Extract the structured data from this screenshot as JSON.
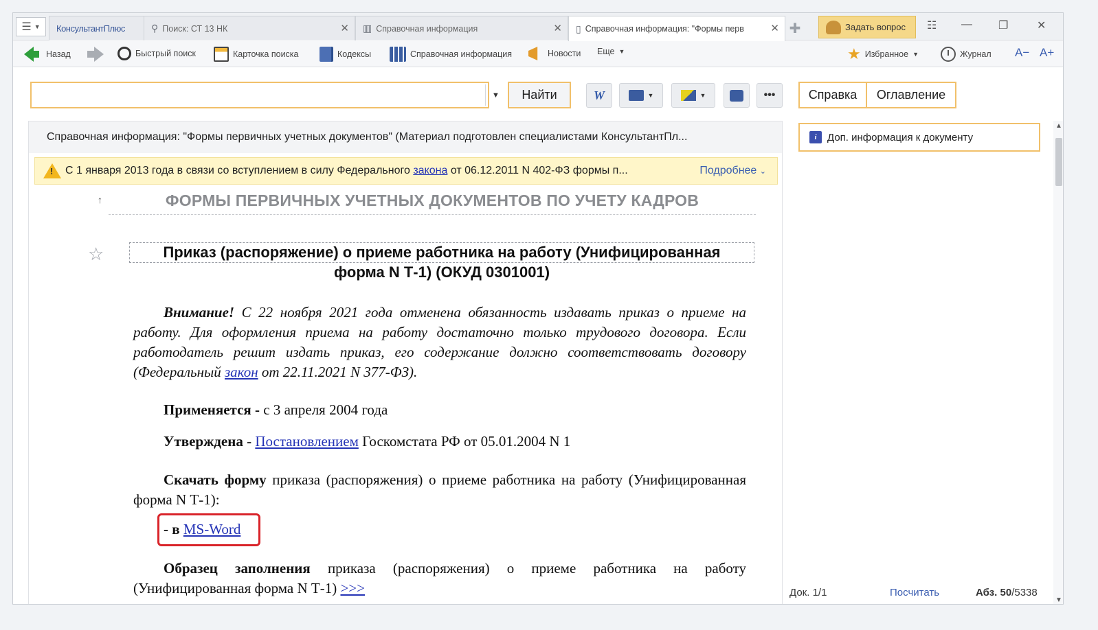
{
  "tabs": {
    "brand": "КонсультантПлюс",
    "search_tab": "Поиск: СТ 13 НК",
    "ref_tab": "Справочная информация",
    "active_tab": "Справочная информация: \"Формы перв",
    "ask": "Задать вопрос"
  },
  "toolbar": {
    "back": "Назад",
    "quick_search": "Быстрый поиск",
    "search_card": "Карточка поиска",
    "codes": "Кодексы",
    "reference": "Справочная информация",
    "news": "Новости",
    "more": "Еще",
    "favorites": "Избранное",
    "journal": "Журнал",
    "font_minus": "A−",
    "font_plus": "A+"
  },
  "search": {
    "value": "",
    "find": "Найти"
  },
  "side_tabs": {
    "help": "Справка",
    "contents": "Оглавление",
    "extra_info": "Доп. информация к документу"
  },
  "document": {
    "title": "Справочная информация: \"Формы первичных учетных документов\" (Материал подготовлен специалистами КонсультантПл...",
    "notice_pre": "С 1 января 2013 года в связи со вступлением в силу Федерального",
    "notice_link": "закона",
    "notice_post": "от 06.12.2011 N 402-ФЗ формы п...",
    "notice_more": "Подробнее",
    "section_heading": "ФОРМЫ ПЕРВИЧНЫХ УЧЕТНЫХ ДОКУМЕНТОВ ПО УЧЕТУ КАДРОВ",
    "form_title_1": "Приказ (распоряжение) о приеме работника на работу (Унифицированная",
    "form_title_2": "форма N Т-1) (ОКУД 0301001)",
    "attention_bold": "Внимание!",
    "attention_text": "С 22 ноября 2021 года отменена обязанность издавать приказ о приеме на работу. Для оформления приема на работу достаточно только трудового договора. Если работодатель решит издать приказ, его содержание должно соответствовать договору (Федеральный",
    "attention_link": "закон",
    "attention_tail": "от 22.11.2021 N 377-ФЗ).",
    "applies_label": "Применяется -",
    "applies_value": "с 3 апреля 2004 года",
    "approved_label": "Утверждена -",
    "approved_link": "Постановлением",
    "approved_tail": "Госкомстата РФ от 05.01.2004 N 1",
    "download_label": "Скачать форму",
    "download_text": "приказа (распоряжения) о приеме работника на работу (Унифицированная форма N Т-1):",
    "msword_prefix": "- в",
    "msword_link": "MS-Word",
    "sample_label": "Образец заполнения",
    "sample_text": "приказа (распоряжения) о приеме работника на работу (Унифицированная форма N Т-1)",
    "sample_link": ">>>"
  },
  "status": {
    "doc": "Док. 1/1",
    "count": "Посчитать",
    "para_label": "Абз. 50",
    "para_total": "/5338"
  },
  "colors": {
    "accent_border": "#f1c06a",
    "link": "#2433b6",
    "highlight_box": "#d9242a",
    "notice_bg": "#fff6c9"
  }
}
